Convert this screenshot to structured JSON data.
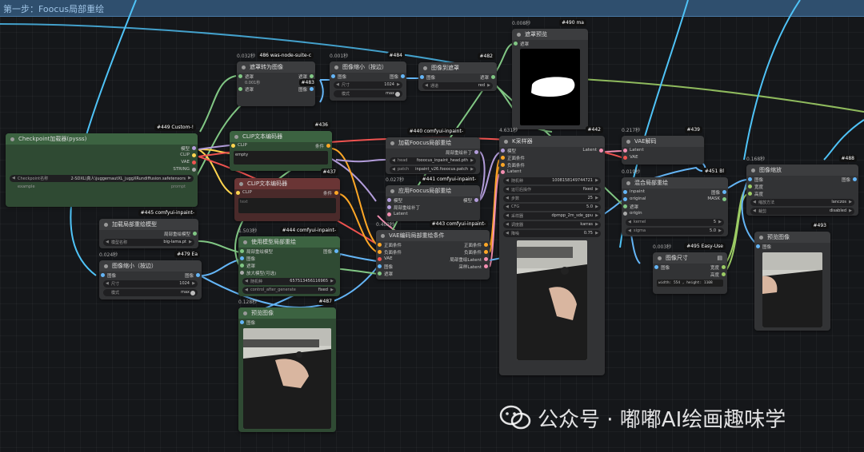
{
  "group": {
    "title": "第一步：Foocus局部重绘"
  },
  "nodes": {
    "n486": {
      "id": "#486",
      "title": "486 was-node-suite-c",
      "time": "0.032秒",
      "sub_title": "遮罩转为图像",
      "sub_time": "0.001秒",
      "sub_id": "#483",
      "in_mask": "遮罩",
      "out_image": "图像",
      "in_image": "遮罩",
      "out_mask": "图像"
    },
    "n484": {
      "id": "#484",
      "title": "图像缩小（按边）",
      "time": "0.001秒",
      "in_image": "图像",
      "out_image": "图像",
      "w_size_l": "尺寸",
      "w_size_v": "1024",
      "w_mode_l": "模式",
      "w_mode_v": "max"
    },
    "n482": {
      "id": "#482",
      "title": "图像到遮罩",
      "in_image": "图像",
      "out_mask": "遮罩",
      "w_ch_l": "通道",
      "w_ch_v": "red"
    },
    "n490": {
      "id": "#490",
      "title": "遮罩预览",
      "time": "0.008秒",
      "hdr": "#490 ma",
      "in_mask": "遮罩"
    },
    "n449": {
      "id": "#449 Custom-!",
      "title": "Checkpoint加载器(pysss)",
      "out_model": "模型",
      "out_clip": "CLIP",
      "out_vae": "VAE",
      "out_str": "STRING",
      "w_ckpt_l": "Checkpoint名称",
      "w_ckpt_v": "2-SDXL\\真人\\juggernautXL_juggXRundiffusion.safetensors",
      "w_ex_l": "example",
      "w_ex_v": "prompt"
    },
    "n436": {
      "id": "#436",
      "title": "CLIP文本编码器",
      "in_clip": "CLIP",
      "out_cond": "条件",
      "text": "empty"
    },
    "n437": {
      "id": "#437",
      "title": "CLIP文本编码器",
      "in_clip": "CLIP",
      "out_cond": "条件",
      "text": "text"
    },
    "n440": {
      "id": "#440 comfyui-inpaint-",
      "badge": "#440",
      "title": "加载Foocus局部重绘",
      "out": "局部重绘补丁",
      "w_head_l": "head",
      "w_head_v": "fooocus_inpaint_head.pth",
      "w_patch_l": "patch",
      "w_patch_v": "inpaint_v26.fooocus.patch"
    },
    "n441": {
      "id": "#441 comfyui-inpaint-",
      "time": "0.027秒",
      "title": "应用Foocus局部重绘",
      "in_model": "模型",
      "in_patch": "局部重绘补丁",
      "in_latent": "Latent",
      "out_model": "模型"
    },
    "n443": {
      "id": "#443 comfyui-inpaint-",
      "time": "0.402秒",
      "title": "VAE编码局部重绘条件",
      "in_pos": "正面条件",
      "in_neg": "负面条件",
      "in_vae": "VAE",
      "in_image": "图像",
      "in_mask": "遮罩",
      "out_pos": "正面条件",
      "out_neg": "负面条件",
      "out_latent": "局部重绘Latent",
      "out_samp": "采样Latent"
    },
    "n442": {
      "id": "#442",
      "time": "4.631秒",
      "title": "K采样器",
      "in_model": "模型",
      "in_pos": "正面条件",
      "in_neg": "负面条件",
      "in_latent": "Latent",
      "out_latent": "Latent",
      "widgets": [
        {
          "l": "随机种",
          "v": "1008158149744721"
        },
        {
          "l": "运行后操作",
          "v": "fixed"
        },
        {
          "l": "步数",
          "v": "25"
        },
        {
          "l": "CFG",
          "v": "5.0"
        },
        {
          "l": "采样器",
          "v": "dpmpp_2m_sde_gpu"
        },
        {
          "l": "调度器",
          "v": "karras"
        },
        {
          "l": "降噪",
          "v": "0.75"
        }
      ]
    },
    "n439": {
      "id": "#439",
      "time": "0.217秒",
      "title": "VAE解码",
      "in_latent": "Latent",
      "in_vae": "VAE",
      "out_image": "图像"
    },
    "n451": {
      "id": "#451",
      "hdr": "#451 Bl",
      "time": "0.019秒",
      "title": "混合局部重绘",
      "in_inpaint": "inpaint",
      "in_original": "original",
      "in_mask": "遮罩",
      "in_origin": "origin",
      "out_image": "图像",
      "out_mask": "MASK",
      "w_k_l": "kernel",
      "w_k_v": "5",
      "w_s_l": "sigma",
      "w_s_v": "5.0"
    },
    "n495": {
      "id": "#495 Easy-Use",
      "time": "0.003秒",
      "title": "图像尺寸",
      "in_image": "图像",
      "out_w": "宽度",
      "out_h": "高度",
      "text": "width: 554 , height: 1108"
    },
    "n488": {
      "id": "#488",
      "time": "0.168秒",
      "title": "图像缩放",
      "in_image": "图像",
      "in_w": "宽度",
      "in_h": "高度",
      "out_image": "图像",
      "w_m_l": "缩放方法",
      "w_m_v": "lanczos",
      "w_c_l": "裁剪",
      "w_c_v": "disabled"
    },
    "n493": {
      "id": "#493",
      "title": "预览图像",
      "in_image": "图像"
    },
    "n445": {
      "id": "#445 comfyui-inpaint-",
      "badge": "#445",
      "title": "加载局部重绘模型",
      "out": "局部重绘模型",
      "w_l": "模型名称",
      "w_v": "big-lama.pt"
    },
    "n479": {
      "id": "#479",
      "hdr": "#479 Ea",
      "time": "0.024秒",
      "title": "图像缩小（按边）",
      "in_image": "图像",
      "out_image": "图像",
      "w_size_l": "尺寸",
      "w_size_v": "1024",
      "w_mode_l": "模式",
      "w_mode_v": "max"
    },
    "n444": {
      "id": "#444",
      "hdr": "#444 comfyui-inpaint-",
      "time": "1.503秒",
      "title": "使用模型局部重绘",
      "in_model": "局部重绘模型",
      "in_image": "图像",
      "in_mask": "遮罩",
      "in_up": "放大模型(可选)",
      "out_image": "图像",
      "w_seed_l": "随机种",
      "w_seed_v": "657513456116965",
      "w_ctrl_l": "control_after_generate",
      "w_ctrl_v": "fixed"
    },
    "n487": {
      "id": "#487",
      "time": "0.128秒",
      "title": "预览图像",
      "in_image": "图像"
    }
  },
  "watermark": {
    "text": "公众号 · 嘟嘟AI绘画趣味学"
  },
  "colors": {
    "model": "#b39ddb",
    "clip": "#ffd54f",
    "vae": "#ef5350",
    "cond": "#ffa726",
    "latent": "#f48fb1",
    "image": "#64b5f6",
    "mask": "#81c784",
    "group": "#2f4f6e"
  }
}
